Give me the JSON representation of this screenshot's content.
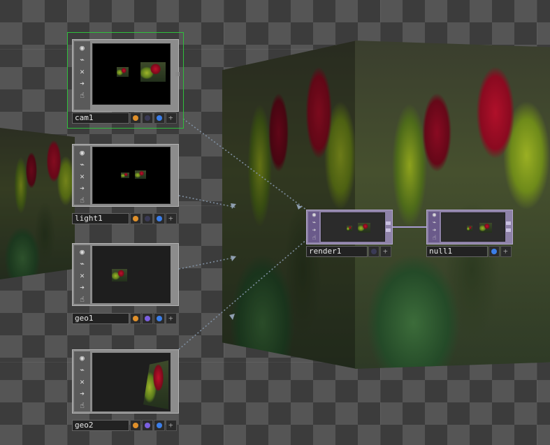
{
  "canvas": {
    "background": "checkerboard"
  },
  "colors": {
    "selection_outline": "#2fbf3c",
    "comp_node": "#8e82a8",
    "flag_orange": "#e0902a",
    "flag_purple": "#7b5fe0",
    "flag_blue": "#3b7ee8",
    "flag_off": "#3a3a55",
    "wire": "#7f8fa0"
  },
  "nodes": {
    "cam1": {
      "name": "cam1",
      "sidebar_icons": [
        "viewer-icon",
        "bypass-icon",
        "close-icon",
        "arrow-right-icon",
        "lock-icon"
      ],
      "flags": [
        "flag_orange",
        "flag_off",
        "flag_blue",
        "plus"
      ]
    },
    "light1": {
      "name": "light1",
      "sidebar_icons": [
        "viewer-icon",
        "bypass-icon",
        "close-icon",
        "arrow-right-icon",
        "lock-icon"
      ],
      "flags": [
        "flag_orange",
        "flag_off",
        "flag_blue",
        "plus"
      ]
    },
    "geo1": {
      "name": "geo1",
      "sidebar_icons": [
        "viewer-icon",
        "bypass-icon",
        "close-icon",
        "arrow-right-icon",
        "lock-icon"
      ],
      "flags": [
        "flag_orange",
        "flag_purple",
        "flag_blue",
        "plus"
      ]
    },
    "geo2": {
      "name": "geo2",
      "sidebar_icons": [
        "viewer-icon",
        "bypass-icon",
        "close-icon",
        "arrow-right-icon",
        "lock-icon"
      ],
      "flags": [
        "flag_orange",
        "flag_purple",
        "flag_blue",
        "plus"
      ]
    },
    "render1": {
      "name": "render1",
      "sidebar_icons": [
        "viewer-icon",
        "bypass-icon",
        "arrow-right-icon",
        "lock-icon"
      ],
      "flags": [
        "flag_off",
        "plus"
      ]
    },
    "null1": {
      "name": "null1",
      "sidebar_icons": [
        "viewer-icon",
        "bypass-icon",
        "arrow-right-icon",
        "lock-icon"
      ],
      "flags": [
        "flag_blue",
        "plus"
      ]
    }
  }
}
